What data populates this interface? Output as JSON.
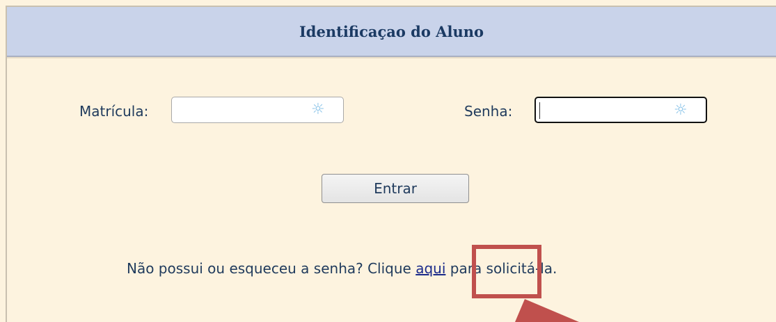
{
  "header": {
    "title": "Identificaçao do Aluno"
  },
  "form": {
    "matricula_label": "Matrícula:",
    "matricula_value": "",
    "senha_label": "Senha:",
    "senha_value": "",
    "submit_label": "Entrar"
  },
  "help": {
    "text_before": "Não possui ou esqueceu a senha? Clique ",
    "link_text": "aqui",
    "text_after": " para solicitá-la."
  },
  "icons": {
    "field_icon": "password-manager-icon",
    "annotation_arrow": "arrow-icon"
  },
  "colors": {
    "header_bg": "#c9d3ea",
    "page_bg": "#fdf3df",
    "highlight": "#c0504d",
    "text": "#1f3a5c"
  }
}
